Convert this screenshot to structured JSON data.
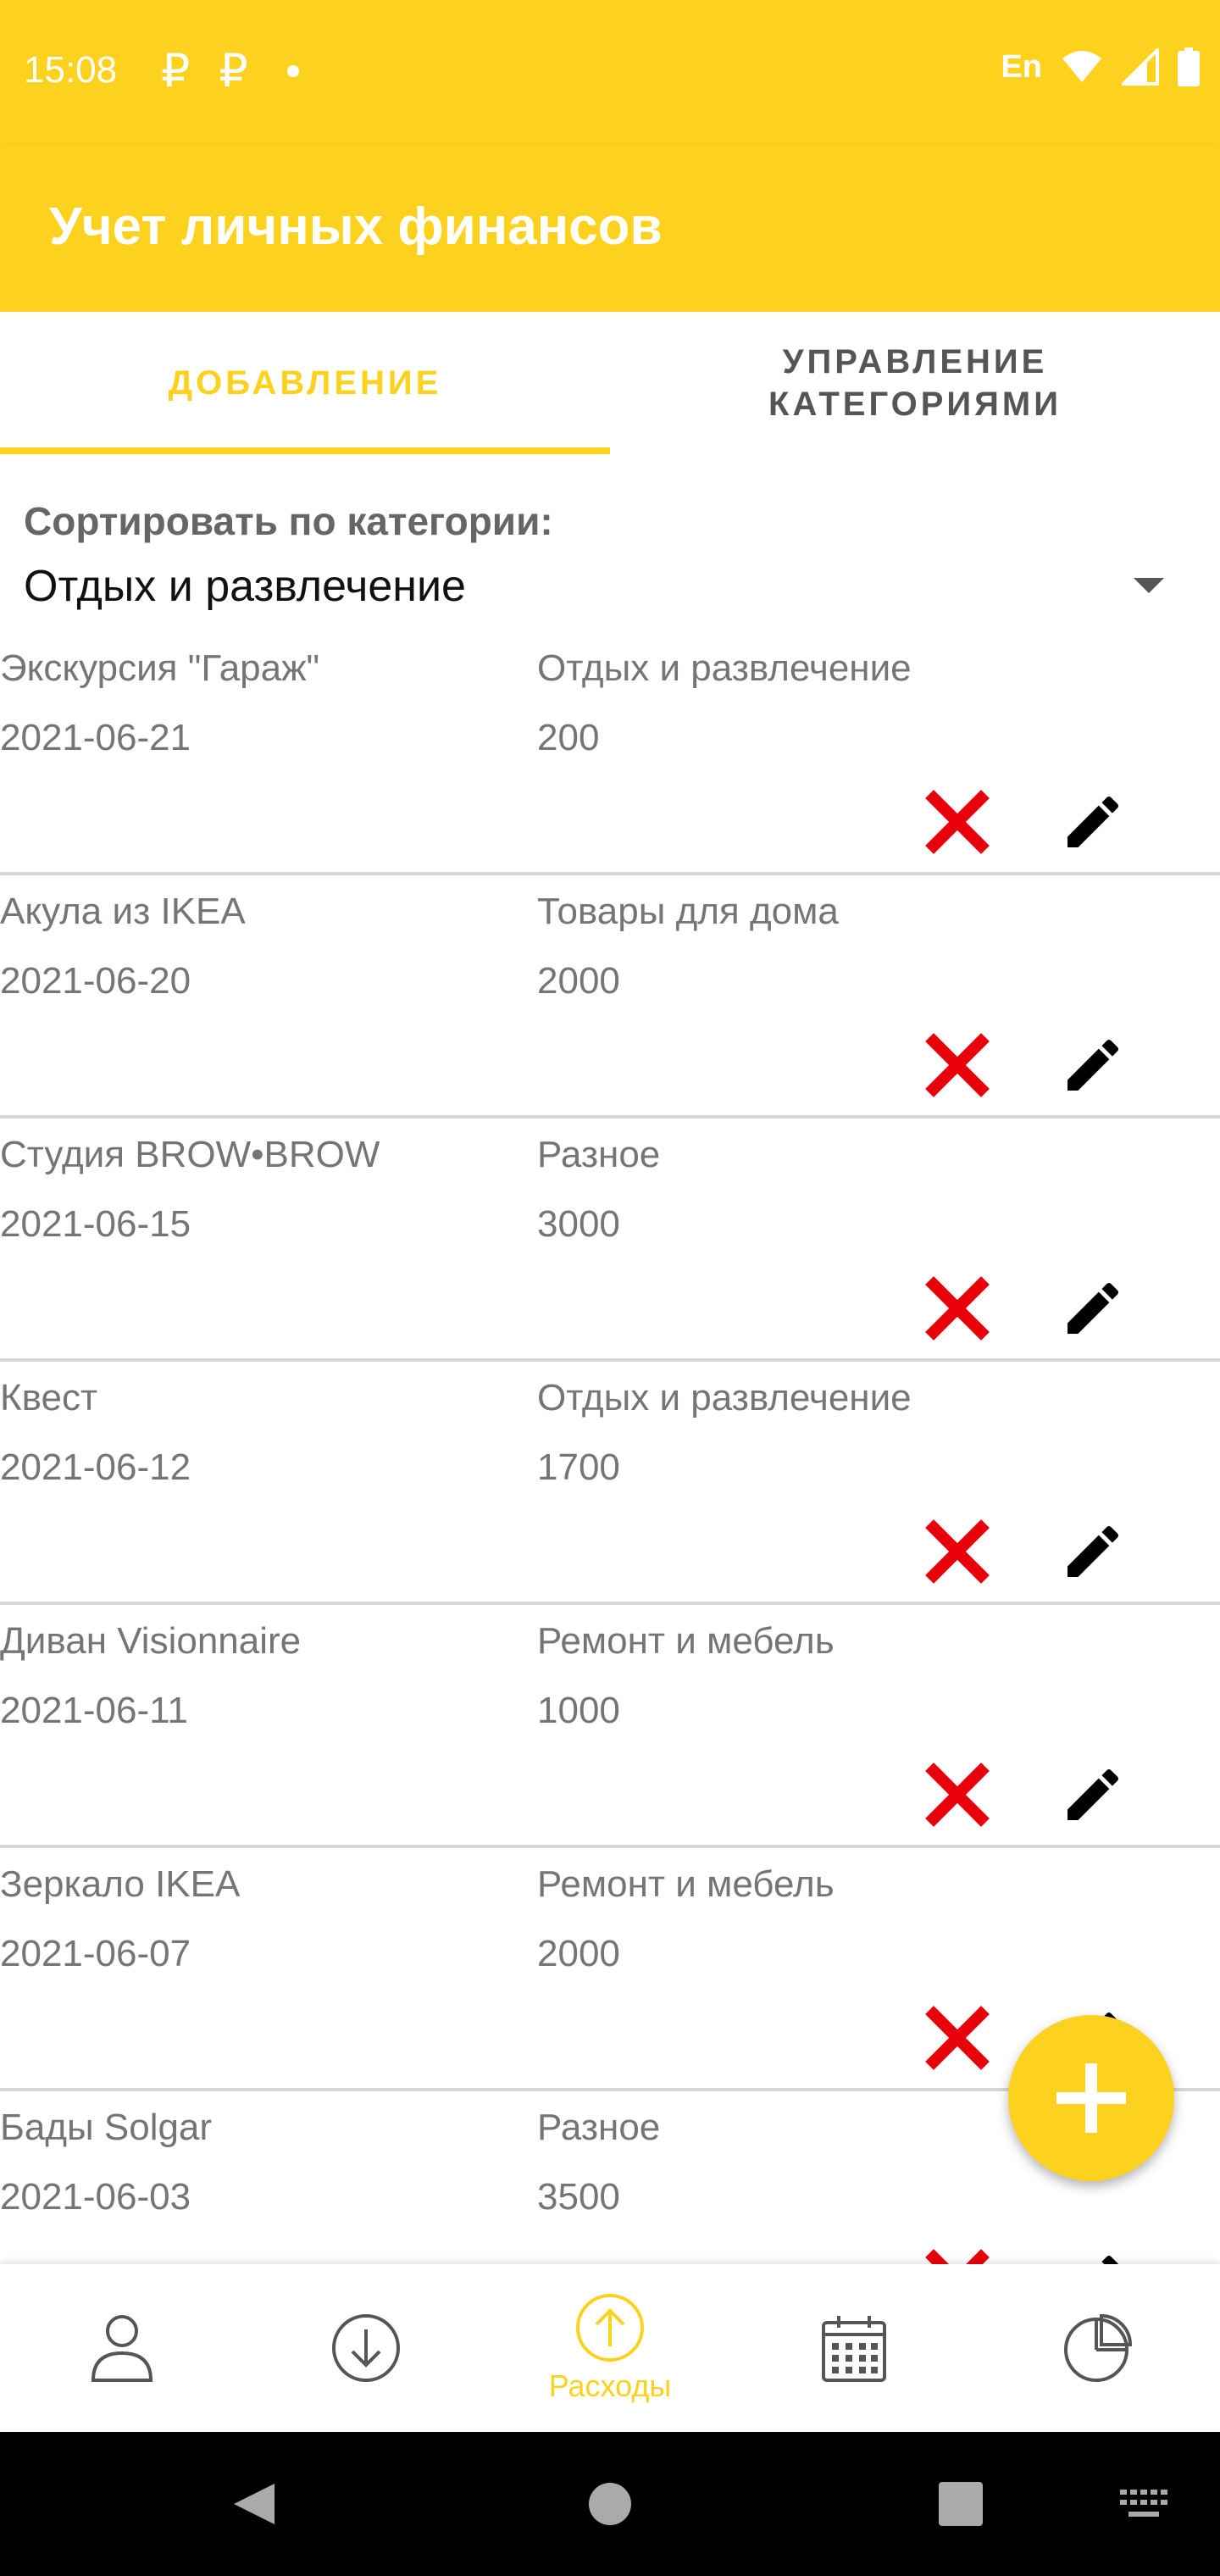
{
  "status_bar": {
    "time": "15:08",
    "currency_icon": "₽",
    "lang": "En",
    "icons": [
      "ruble-icon",
      "ruble-icon",
      "notification-dot-icon",
      "wifi-icon",
      "signal-icon",
      "battery-icon"
    ]
  },
  "app_bar": {
    "title": "Учет личных финансов"
  },
  "tabs": [
    {
      "label": "ДОБАВЛЕНИЕ",
      "active": true
    },
    {
      "label_line1": "УПРАВЛЕНИЕ",
      "label_line2": "КАТЕГОРИЯМИ",
      "active": false
    }
  ],
  "sort": {
    "label": "Сортировать по категории:",
    "selected": "Отдых и развлечение"
  },
  "expenses": [
    {
      "name": "Экскурсия \"Гараж\"",
      "date": "2021-06-21",
      "category": "Отдых и развлечение",
      "amount": "200"
    },
    {
      "name": "Акула из IKEA",
      "date": "2021-06-20",
      "category": "Товары для дома",
      "amount": "2000"
    },
    {
      "name": "Студия BROW•BROW",
      "date": "2021-06-15",
      "category": "Разное",
      "amount": "3000"
    },
    {
      "name": "Квест",
      "date": "2021-06-12",
      "category": "Отдых и развлечение",
      "amount": "1700"
    },
    {
      "name": "Диван Visionnaire",
      "date": "2021-06-11",
      "category": "Ремонт и мебель",
      "amount": "1000"
    },
    {
      "name": "Зеркало IKEA",
      "date": "2021-06-07",
      "category": "Ремонт и мебель",
      "amount": "2000"
    },
    {
      "name": "Бады Solgar",
      "date": "2021-06-03",
      "category": "Разное",
      "amount": "3500"
    }
  ],
  "bottom_nav": [
    {
      "icon": "person-icon",
      "label": "",
      "active": false
    },
    {
      "icon": "arrow-down-circle-icon",
      "label": "",
      "active": false
    },
    {
      "icon": "arrow-up-circle-icon",
      "label": "Расходы",
      "active": true
    },
    {
      "icon": "calendar-icon",
      "label": "",
      "active": false
    },
    {
      "icon": "pie-chart-icon",
      "label": "",
      "active": false
    }
  ],
  "colors": {
    "accent": "#FDD21F",
    "delete": "#E8000B",
    "text_secondary": "#757575",
    "divider": "#D7D7D7"
  }
}
